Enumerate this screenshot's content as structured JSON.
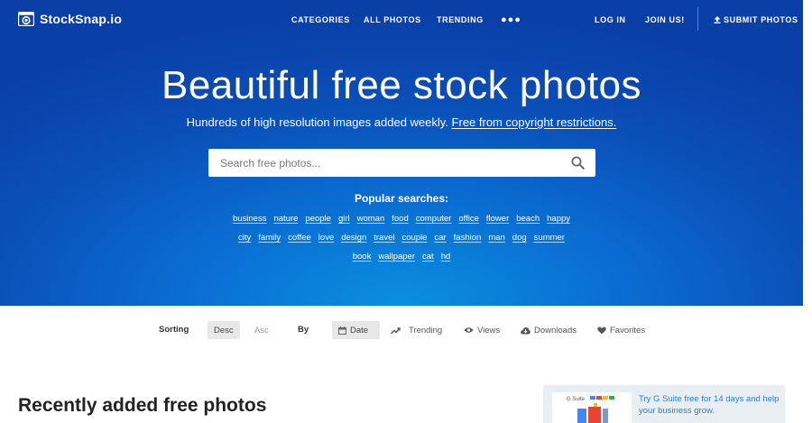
{
  "nav": {
    "logo_text": "StockSnap.io",
    "links": [
      "CATEGORIES",
      "ALL PHOTOS",
      "TRENDING"
    ],
    "more_icon": "more-dots-icon",
    "login": "LOG IN",
    "join": "JOIN US!",
    "submit": "SUBMIT PHOTOS"
  },
  "hero": {
    "title": "Beautiful free stock photos",
    "subtitle": "Hundreds of high resolution images added weekly.",
    "subtitle_link": "Free from copyright restrictions.",
    "search_placeholder": "Search free photos...",
    "popular_title": "Popular searches:",
    "tags": [
      [
        "business",
        "nature",
        "people",
        "girl",
        "woman",
        "food",
        "computer",
        "office",
        "flower",
        "beach",
        "happy"
      ],
      [
        "city",
        "family",
        "coffee",
        "love",
        "design",
        "travel",
        "couple",
        "car",
        "fashion",
        "man",
        "dog",
        "summer"
      ],
      [
        "book",
        "wallpaper",
        "cat",
        "hd"
      ]
    ]
  },
  "sorting": {
    "label": "Sorting",
    "desc": "Desc",
    "asc": "Asc",
    "by_label": "By",
    "date": "Date",
    "trending": "Trending",
    "views": "Views",
    "downloads": "Downloads",
    "favorites": "Favorites"
  },
  "main": {
    "recent_title": "Recently added free photos"
  },
  "ad": {
    "image_label": "G Suite",
    "text": "Try G Suite free for 14 days and help your business grow."
  },
  "colors": {
    "hero_top": "#0a3fa8",
    "hero_glow": "#0a8fe0",
    "ad_link": "#2c7fc3",
    "active_pill": "#e8e8e8"
  }
}
